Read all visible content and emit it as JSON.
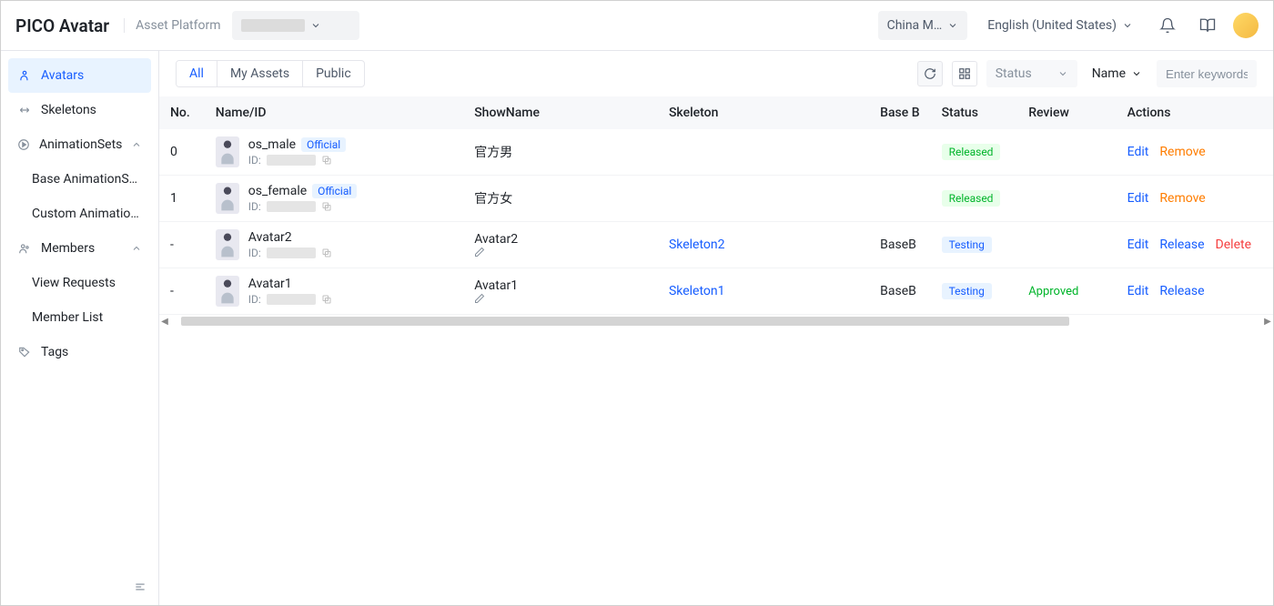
{
  "header": {
    "brand": "PICO Avatar",
    "brandSub": "Asset Platform",
    "region": "China M…",
    "language": "English (United States)"
  },
  "sidebar": {
    "avatars": "Avatars",
    "skeletons": "Skeletons",
    "animationSets": "AnimationSets",
    "baseAnim": "Base AnimationS…",
    "customAnim": "Custom Animatio…",
    "members": "Members",
    "viewRequests": "View Requests",
    "memberList": "Member List",
    "tags": "Tags"
  },
  "tabs": {
    "all": "All",
    "my": "My Assets",
    "public": "Public"
  },
  "toolbar": {
    "statusPlaceholder": "Status",
    "sortLabel": "Name",
    "searchPlaceholder": "Enter keywords"
  },
  "columns": {
    "no": "No.",
    "nameId": "Name/ID",
    "showName": "ShowName",
    "skeleton": "Skeleton",
    "baseB": "Base B",
    "status": "Status",
    "review": "Review",
    "actions": "Actions"
  },
  "labels": {
    "idPrefix": "ID:",
    "official": "Official",
    "edit": "Edit",
    "remove": "Remove",
    "release": "Release",
    "delete": "Delete"
  },
  "status": {
    "released": "Released",
    "testing": "Testing"
  },
  "review": {
    "approved": "Approved"
  },
  "rows": [
    {
      "no": "0",
      "name": "os_male",
      "official": true,
      "showName": "官方男",
      "skeleton": "",
      "base": "",
      "status": "released",
      "review": "",
      "actions": [
        "edit",
        "remove"
      ]
    },
    {
      "no": "1",
      "name": "os_female",
      "official": true,
      "showName": "官方女",
      "skeleton": "",
      "base": "",
      "status": "released",
      "review": "",
      "actions": [
        "edit",
        "remove"
      ]
    },
    {
      "no": "-",
      "name": "Avatar2",
      "official": false,
      "showName": "Avatar2",
      "showEditable": true,
      "skeleton": "Skeleton2",
      "base": "BaseB",
      "status": "testing",
      "review": "",
      "actions": [
        "edit",
        "release",
        "delete"
      ]
    },
    {
      "no": "-",
      "name": "Avatar1",
      "official": false,
      "showName": "Avatar1",
      "showEditable": true,
      "skeleton": "Skeleton1",
      "base": "BaseB",
      "status": "testing",
      "review": "approved",
      "actions": [
        "edit",
        "release"
      ]
    }
  ]
}
